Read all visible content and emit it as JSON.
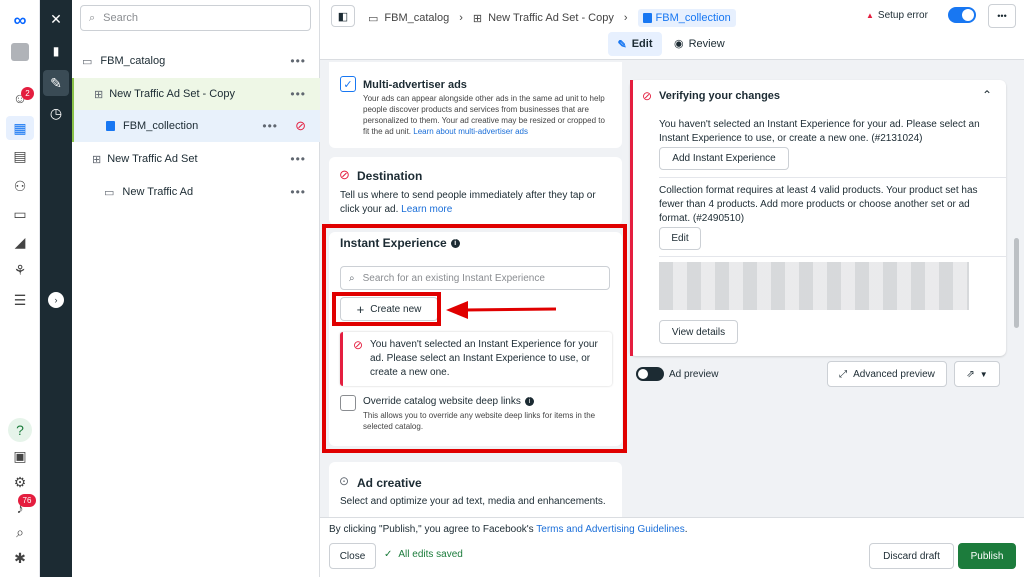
{
  "search": {
    "placeholder": "Search"
  },
  "badges": {
    "notifications": "2",
    "alerts": "76"
  },
  "tree": {
    "items": [
      {
        "label": "FBM_catalog"
      },
      {
        "label": "New Traffic Ad Set - Copy"
      },
      {
        "label": "FBM_collection"
      },
      {
        "label": "New Traffic Ad Set"
      },
      {
        "label": "New Traffic Ad"
      }
    ],
    "dots": "•••"
  },
  "breadcrumb": {
    "items": [
      "FBM_catalog",
      "New Traffic Ad Set - Copy",
      "FBM_collection"
    ],
    "separator": "›"
  },
  "header": {
    "status": "Setup error",
    "more": "•••"
  },
  "modes": {
    "edit": "Edit",
    "review": "Review"
  },
  "multi": {
    "title": "Multi-advertiser ads",
    "desc": "Your ads can appear alongside other ads in the same ad unit to help people discover products and services from businesses that are personalized to them. Your ad creative may be resized or cropped to fit the ad unit.",
    "link": "Learn about multi-advertiser ads"
  },
  "destination": {
    "title": "Destination",
    "desc": "Tell us where to send people immediately after they tap or click your ad.",
    "link": "Learn more"
  },
  "instant": {
    "title": "Instant Experience",
    "search_placeholder": "Search for an existing Instant Experience",
    "create": "Create new",
    "error": "You haven't selected an Instant Experience for your ad. Please select an Instant Experience to use, or create a new one.",
    "override_title": "Override catalog website deep links",
    "override_desc": "This allows you to override any website deep links for items in the selected catalog."
  },
  "creative": {
    "title": "Ad creative",
    "desc": "Select and optimize your ad text, media and enhancements."
  },
  "verify": {
    "title": "Verifying your changes",
    "msg1": "You haven't selected an Instant Experience for your ad. Please select an Instant Experience to use, or create a new one. (#2131024)",
    "btn1": "Add Instant Experience",
    "msg2": "Collection format requires at least 4 valid products. Your product set has fewer than 4 products. Add more products or choose another set or ad format. (#2490510)",
    "btn2": "Edit",
    "btn3": "View details"
  },
  "preview": {
    "label": "Ad preview",
    "advanced": "Advanced preview"
  },
  "footer": {
    "text": "By clicking \"Publish,\" you agree to Facebook's",
    "link": "Terms and Advertising Guidelines",
    "period": ".",
    "close": "Close",
    "saved": "All edits saved",
    "discard": "Discard draft",
    "publish": "Publish"
  },
  "colors": {
    "accent": "#1877f2",
    "error": "#e41e3f",
    "publish": "#1c7c3c",
    "highlight": "#e00000"
  }
}
